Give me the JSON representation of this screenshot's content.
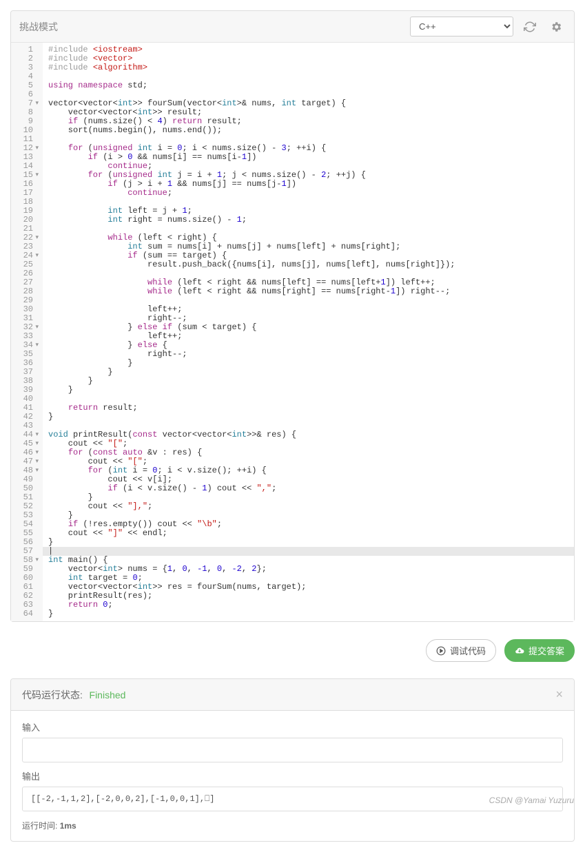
{
  "toolbar": {
    "title": "挑战模式",
    "language": "C++"
  },
  "actions": {
    "debug": "调试代码",
    "submit": "提交答案"
  },
  "status": {
    "label": "代码运行状态:",
    "value": "Finished",
    "input_label": "输入",
    "input_value": "",
    "output_label": "输出",
    "output_value": "[[-2,-1,1,2],[-2,0,0,2],[-1,0,0,1],⎕]",
    "runtime_label": "运行时间:",
    "runtime_value": "1ms"
  },
  "watermark": "CSDN @Yamai Yuzuru",
  "code": {
    "lines": [
      {
        "n": 1,
        "fold": "",
        "tokens": [
          [
            "pre",
            "#include "
          ],
          [
            "lib",
            "<iostream>"
          ]
        ]
      },
      {
        "n": 2,
        "fold": "",
        "tokens": [
          [
            "pre",
            "#include "
          ],
          [
            "lib",
            "<vector>"
          ]
        ]
      },
      {
        "n": 3,
        "fold": "",
        "tokens": [
          [
            "pre",
            "#include "
          ],
          [
            "lib",
            "<algorithm>"
          ]
        ]
      },
      {
        "n": 4,
        "fold": "",
        "tokens": []
      },
      {
        "n": 5,
        "fold": "",
        "tokens": [
          [
            "key",
            "using"
          ],
          [
            "id",
            " "
          ],
          [
            "key",
            "namespace"
          ],
          [
            "id",
            " std;"
          ]
        ]
      },
      {
        "n": 6,
        "fold": "",
        "tokens": []
      },
      {
        "n": 7,
        "fold": "▾",
        "tokens": [
          [
            "id",
            "vector<vector<"
          ],
          [
            "type",
            "int"
          ],
          [
            "id",
            ">> fourSum(vector<"
          ],
          [
            "type",
            "int"
          ],
          [
            "id",
            ">& nums, "
          ],
          [
            "type",
            "int"
          ],
          [
            "id",
            " target) {"
          ]
        ]
      },
      {
        "n": 8,
        "fold": "",
        "tokens": [
          [
            "id",
            "    vector<vector<"
          ],
          [
            "type",
            "int"
          ],
          [
            "id",
            ">> result;"
          ]
        ]
      },
      {
        "n": 9,
        "fold": "",
        "tokens": [
          [
            "id",
            "    "
          ],
          [
            "key",
            "if"
          ],
          [
            "id",
            " (nums.size() < "
          ],
          [
            "num",
            "4"
          ],
          [
            "id",
            ") "
          ],
          [
            "key",
            "return"
          ],
          [
            "id",
            " result;"
          ]
        ]
      },
      {
        "n": 10,
        "fold": "",
        "tokens": [
          [
            "id",
            "    sort(nums.begin(), nums.end());"
          ]
        ]
      },
      {
        "n": 11,
        "fold": "",
        "tokens": []
      },
      {
        "n": 12,
        "fold": "▾",
        "tokens": [
          [
            "id",
            "    "
          ],
          [
            "key",
            "for"
          ],
          [
            "id",
            " ("
          ],
          [
            "key",
            "unsigned"
          ],
          [
            "id",
            " "
          ],
          [
            "type",
            "int"
          ],
          [
            "id",
            " i = "
          ],
          [
            "num",
            "0"
          ],
          [
            "id",
            "; i < nums.size() - "
          ],
          [
            "num",
            "3"
          ],
          [
            "id",
            "; ++i) {"
          ]
        ]
      },
      {
        "n": 13,
        "fold": "",
        "tokens": [
          [
            "id",
            "        "
          ],
          [
            "key",
            "if"
          ],
          [
            "id",
            " (i > "
          ],
          [
            "num",
            "0"
          ],
          [
            "id",
            " && nums[i] == nums[i-"
          ],
          [
            "num",
            "1"
          ],
          [
            "id",
            "])"
          ]
        ]
      },
      {
        "n": 14,
        "fold": "",
        "tokens": [
          [
            "id",
            "            "
          ],
          [
            "key",
            "continue"
          ],
          [
            "id",
            ";"
          ]
        ]
      },
      {
        "n": 15,
        "fold": "▾",
        "tokens": [
          [
            "id",
            "        "
          ],
          [
            "key",
            "for"
          ],
          [
            "id",
            " ("
          ],
          [
            "key",
            "unsigned"
          ],
          [
            "id",
            " "
          ],
          [
            "type",
            "int"
          ],
          [
            "id",
            " j = i + "
          ],
          [
            "num",
            "1"
          ],
          [
            "id",
            "; j < nums.size() - "
          ],
          [
            "num",
            "2"
          ],
          [
            "id",
            "; ++j) {"
          ]
        ]
      },
      {
        "n": 16,
        "fold": "",
        "tokens": [
          [
            "id",
            "            "
          ],
          [
            "key",
            "if"
          ],
          [
            "id",
            " (j > i + "
          ],
          [
            "num",
            "1"
          ],
          [
            "id",
            " && nums[j] == nums[j-"
          ],
          [
            "num",
            "1"
          ],
          [
            "id",
            "])"
          ]
        ]
      },
      {
        "n": 17,
        "fold": "",
        "tokens": [
          [
            "id",
            "                "
          ],
          [
            "key",
            "continue"
          ],
          [
            "id",
            ";"
          ]
        ]
      },
      {
        "n": 18,
        "fold": "",
        "tokens": []
      },
      {
        "n": 19,
        "fold": "",
        "tokens": [
          [
            "id",
            "            "
          ],
          [
            "type",
            "int"
          ],
          [
            "id",
            " left = j + "
          ],
          [
            "num",
            "1"
          ],
          [
            "id",
            ";"
          ]
        ]
      },
      {
        "n": 20,
        "fold": "",
        "tokens": [
          [
            "id",
            "            "
          ],
          [
            "type",
            "int"
          ],
          [
            "id",
            " right = nums.size() - "
          ],
          [
            "num",
            "1"
          ],
          [
            "id",
            ";"
          ]
        ]
      },
      {
        "n": 21,
        "fold": "",
        "tokens": []
      },
      {
        "n": 22,
        "fold": "▾",
        "tokens": [
          [
            "id",
            "            "
          ],
          [
            "key",
            "while"
          ],
          [
            "id",
            " (left < right) {"
          ]
        ]
      },
      {
        "n": 23,
        "fold": "",
        "tokens": [
          [
            "id",
            "                "
          ],
          [
            "type",
            "int"
          ],
          [
            "id",
            " sum = nums[i] + nums[j] + nums[left] + nums[right];"
          ]
        ]
      },
      {
        "n": 24,
        "fold": "▾",
        "tokens": [
          [
            "id",
            "                "
          ],
          [
            "key",
            "if"
          ],
          [
            "id",
            " (sum == target) {"
          ]
        ]
      },
      {
        "n": 25,
        "fold": "",
        "tokens": [
          [
            "id",
            "                    result.push_back({nums[i], nums[j], nums[left], nums[right]});"
          ]
        ]
      },
      {
        "n": 26,
        "fold": "",
        "tokens": []
      },
      {
        "n": 27,
        "fold": "",
        "tokens": [
          [
            "id",
            "                    "
          ],
          [
            "key",
            "while"
          ],
          [
            "id",
            " (left < right && nums[left] == nums[left+"
          ],
          [
            "num",
            "1"
          ],
          [
            "id",
            "]) left++;"
          ]
        ]
      },
      {
        "n": 28,
        "fold": "",
        "tokens": [
          [
            "id",
            "                    "
          ],
          [
            "key",
            "while"
          ],
          [
            "id",
            " (left < right && nums[right] == nums[right-"
          ],
          [
            "num",
            "1"
          ],
          [
            "id",
            "]) right--;"
          ]
        ]
      },
      {
        "n": 29,
        "fold": "",
        "tokens": []
      },
      {
        "n": 30,
        "fold": "",
        "tokens": [
          [
            "id",
            "                    left++;"
          ]
        ]
      },
      {
        "n": 31,
        "fold": "",
        "tokens": [
          [
            "id",
            "                    right--;"
          ]
        ]
      },
      {
        "n": 32,
        "fold": "▾",
        "tokens": [
          [
            "id",
            "                } "
          ],
          [
            "key",
            "else"
          ],
          [
            "id",
            " "
          ],
          [
            "key",
            "if"
          ],
          [
            "id",
            " (sum < target) {"
          ]
        ]
      },
      {
        "n": 33,
        "fold": "",
        "tokens": [
          [
            "id",
            "                    left++;"
          ]
        ]
      },
      {
        "n": 34,
        "fold": "▾",
        "tokens": [
          [
            "id",
            "                } "
          ],
          [
            "key",
            "else"
          ],
          [
            "id",
            " {"
          ]
        ]
      },
      {
        "n": 35,
        "fold": "",
        "tokens": [
          [
            "id",
            "                    right--;"
          ]
        ]
      },
      {
        "n": 36,
        "fold": "",
        "tokens": [
          [
            "id",
            "                }"
          ]
        ]
      },
      {
        "n": 37,
        "fold": "",
        "tokens": [
          [
            "id",
            "            }"
          ]
        ]
      },
      {
        "n": 38,
        "fold": "",
        "tokens": [
          [
            "id",
            "        }"
          ]
        ]
      },
      {
        "n": 39,
        "fold": "",
        "tokens": [
          [
            "id",
            "    }"
          ]
        ]
      },
      {
        "n": 40,
        "fold": "",
        "tokens": []
      },
      {
        "n": 41,
        "fold": "",
        "tokens": [
          [
            "id",
            "    "
          ],
          [
            "key",
            "return"
          ],
          [
            "id",
            " result;"
          ]
        ]
      },
      {
        "n": 42,
        "fold": "",
        "tokens": [
          [
            "id",
            "}"
          ]
        ]
      },
      {
        "n": 43,
        "fold": "",
        "tokens": []
      },
      {
        "n": 44,
        "fold": "▾",
        "tokens": [
          [
            "type",
            "void"
          ],
          [
            "id",
            " printResult("
          ],
          [
            "key",
            "const"
          ],
          [
            "id",
            " vector<vector<"
          ],
          [
            "type",
            "int"
          ],
          [
            "id",
            ">>& res) {"
          ]
        ]
      },
      {
        "n": 45,
        "fold": "▾",
        "tokens": [
          [
            "id",
            "    cout << "
          ],
          [
            "str",
            "\"[\""
          ],
          [
            "id",
            ";"
          ]
        ]
      },
      {
        "n": 46,
        "fold": "▾",
        "tokens": [
          [
            "id",
            "    "
          ],
          [
            "key",
            "for"
          ],
          [
            "id",
            " ("
          ],
          [
            "key",
            "const"
          ],
          [
            "id",
            " "
          ],
          [
            "key",
            "auto"
          ],
          [
            "id",
            " &v : res) {"
          ]
        ]
      },
      {
        "n": 47,
        "fold": "▾",
        "tokens": [
          [
            "id",
            "        cout << "
          ],
          [
            "str",
            "\"[\""
          ],
          [
            "id",
            ";"
          ]
        ]
      },
      {
        "n": 48,
        "fold": "▾",
        "tokens": [
          [
            "id",
            "        "
          ],
          [
            "key",
            "for"
          ],
          [
            "id",
            " ("
          ],
          [
            "type",
            "int"
          ],
          [
            "id",
            " i = "
          ],
          [
            "num",
            "0"
          ],
          [
            "id",
            "; i < v.size(); ++i) {"
          ]
        ]
      },
      {
        "n": 49,
        "fold": "",
        "tokens": [
          [
            "id",
            "            cout << v[i];"
          ]
        ]
      },
      {
        "n": 50,
        "fold": "",
        "tokens": [
          [
            "id",
            "            "
          ],
          [
            "key",
            "if"
          ],
          [
            "id",
            " (i < v.size() - "
          ],
          [
            "num",
            "1"
          ],
          [
            "id",
            ") cout << "
          ],
          [
            "str",
            "\",\""
          ],
          [
            "id",
            ";"
          ]
        ]
      },
      {
        "n": 51,
        "fold": "",
        "tokens": [
          [
            "id",
            "        }"
          ]
        ]
      },
      {
        "n": 52,
        "fold": "",
        "tokens": [
          [
            "id",
            "        cout << "
          ],
          [
            "str",
            "\"],\""
          ],
          [
            "id",
            ";"
          ]
        ]
      },
      {
        "n": 53,
        "fold": "",
        "tokens": [
          [
            "id",
            "    }"
          ]
        ]
      },
      {
        "n": 54,
        "fold": "",
        "tokens": [
          [
            "id",
            "    "
          ],
          [
            "key",
            "if"
          ],
          [
            "id",
            " (!res.empty()) cout << "
          ],
          [
            "str",
            "\"\\b\""
          ],
          [
            "id",
            ";"
          ]
        ]
      },
      {
        "n": 55,
        "fold": "",
        "tokens": [
          [
            "id",
            "    cout << "
          ],
          [
            "str",
            "\"]\""
          ],
          [
            "id",
            " << endl;"
          ]
        ]
      },
      {
        "n": 56,
        "fold": "",
        "tokens": [
          [
            "id",
            "}"
          ]
        ]
      },
      {
        "n": 57,
        "fold": "",
        "hl": true,
        "tokens": [
          [
            "id",
            "|"
          ]
        ]
      },
      {
        "n": 58,
        "fold": "▾",
        "tokens": [
          [
            "type",
            "int"
          ],
          [
            "id",
            " main() {"
          ]
        ]
      },
      {
        "n": 59,
        "fold": "",
        "tokens": [
          [
            "id",
            "    vector<"
          ],
          [
            "type",
            "int"
          ],
          [
            "id",
            "> nums = {"
          ],
          [
            "num",
            "1"
          ],
          [
            "id",
            ", "
          ],
          [
            "num",
            "0"
          ],
          [
            "id",
            ", "
          ],
          [
            "num",
            "-1"
          ],
          [
            "id",
            ", "
          ],
          [
            "num",
            "0"
          ],
          [
            "id",
            ", "
          ],
          [
            "num",
            "-2"
          ],
          [
            "id",
            ", "
          ],
          [
            "num",
            "2"
          ],
          [
            "id",
            "};"
          ]
        ]
      },
      {
        "n": 60,
        "fold": "",
        "tokens": [
          [
            "id",
            "    "
          ],
          [
            "type",
            "int"
          ],
          [
            "id",
            " target = "
          ],
          [
            "num",
            "0"
          ],
          [
            "id",
            ";"
          ]
        ]
      },
      {
        "n": 61,
        "fold": "",
        "tokens": [
          [
            "id",
            "    vector<vector<"
          ],
          [
            "type",
            "int"
          ],
          [
            "id",
            ">> res = fourSum(nums, target);"
          ]
        ]
      },
      {
        "n": 62,
        "fold": "",
        "tokens": [
          [
            "id",
            "    printResult(res);"
          ]
        ]
      },
      {
        "n": 63,
        "fold": "",
        "tokens": [
          [
            "id",
            "    "
          ],
          [
            "key",
            "return"
          ],
          [
            "id",
            " "
          ],
          [
            "num",
            "0"
          ],
          [
            "id",
            ";"
          ]
        ]
      },
      {
        "n": 64,
        "fold": "",
        "tokens": [
          [
            "id",
            "}"
          ]
        ]
      }
    ]
  }
}
